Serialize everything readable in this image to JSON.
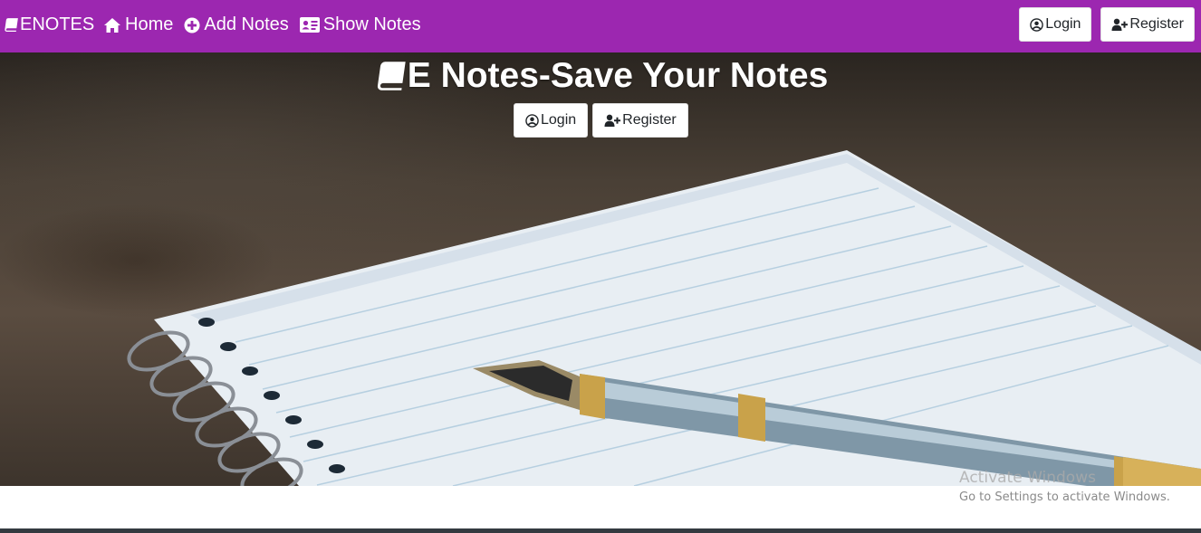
{
  "navbar": {
    "brand": "ENOTES",
    "links": [
      {
        "label": "Home",
        "icon": "home-icon"
      },
      {
        "label": "Add Notes",
        "icon": "plus-circle-icon"
      },
      {
        "label": "Show Notes",
        "icon": "id-card-icon"
      }
    ],
    "login_label": "Login",
    "register_label": "Register"
  },
  "hero": {
    "title": "E Notes-Save Your Notes",
    "login_label": "Login",
    "register_label": "Register"
  },
  "watermark": {
    "line1": "Activate Windows",
    "line2": "Go to Settings to activate Windows."
  },
  "colors": {
    "navbar_bg": "#9c27b0",
    "footer_bar": "#343a40"
  }
}
